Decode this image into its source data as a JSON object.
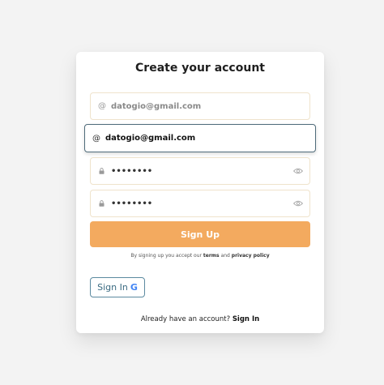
{
  "form": {
    "title": "Create your account",
    "email_1": {
      "value": "datogio@gmail.com",
      "icon": "at-icon"
    },
    "email_2": {
      "value": "datogio@gmail.com",
      "icon": "at-icon"
    },
    "password": {
      "value": "••••••••",
      "icon": "lock-icon"
    },
    "confirm_password": {
      "value": "••••••••",
      "icon": "lock-icon"
    },
    "signup_label": "Sign Up",
    "terms_prefix": "By signing up you accept our",
    "terms_link": "terms",
    "terms_and": "and",
    "privacy_link": "privacy policy",
    "google_label": "Sign In",
    "google_glyph": "G",
    "login_prompt": "Already have an account?",
    "login_link": "Sign In"
  },
  "colors": {
    "accent": "#f3aa5f",
    "focus_border": "#4f6b7a",
    "google_border": "#5c8aa0"
  }
}
